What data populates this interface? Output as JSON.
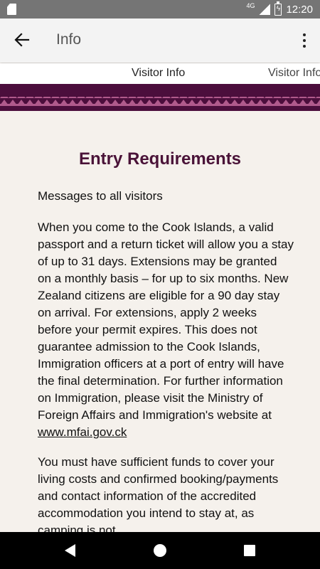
{
  "status_bar": {
    "network": "4G",
    "time": "12:20"
  },
  "app_bar": {
    "title": "Info",
    "back_icon": "arrow-left-icon",
    "menu_icon": "more-vert-icon"
  },
  "tabs": [
    {
      "label": "Visitor Info"
    },
    {
      "label": "Visitor Info"
    }
  ],
  "banner": {
    "color": "#4b0e3c",
    "accent": "#b05a8c"
  },
  "article": {
    "heading": "Entry Requirements",
    "intro": "Messages to all visitors",
    "para1_text": "When you come to the Cook Islands, a valid passport and a return ticket will allow you a stay of up to 31 days. Extensions may be granted on a monthly basis – for up to six months. New Zealand citizens are eligible for a 90 day stay on arrival. For extensions, apply 2 weeks before your permit expires. This does not guarantee admission to the Cook Islands, Immigration officers at a port of entry will have the final determination. For further information on Immigration, please visit the Ministry of Foreign Affairs and Immigration's website at ",
    "para1_link": "www.mfai.gov.ck",
    "para2_text": "You must have sufficient funds to cover your living costs and confirmed booking/payments and contact information of the accredited accommodation you intend to stay at, as camping is not"
  },
  "nav_bar": {
    "back_icon": "triangle-back-icon",
    "home_icon": "circle-home-icon",
    "recents_icon": "square-recents-icon"
  }
}
